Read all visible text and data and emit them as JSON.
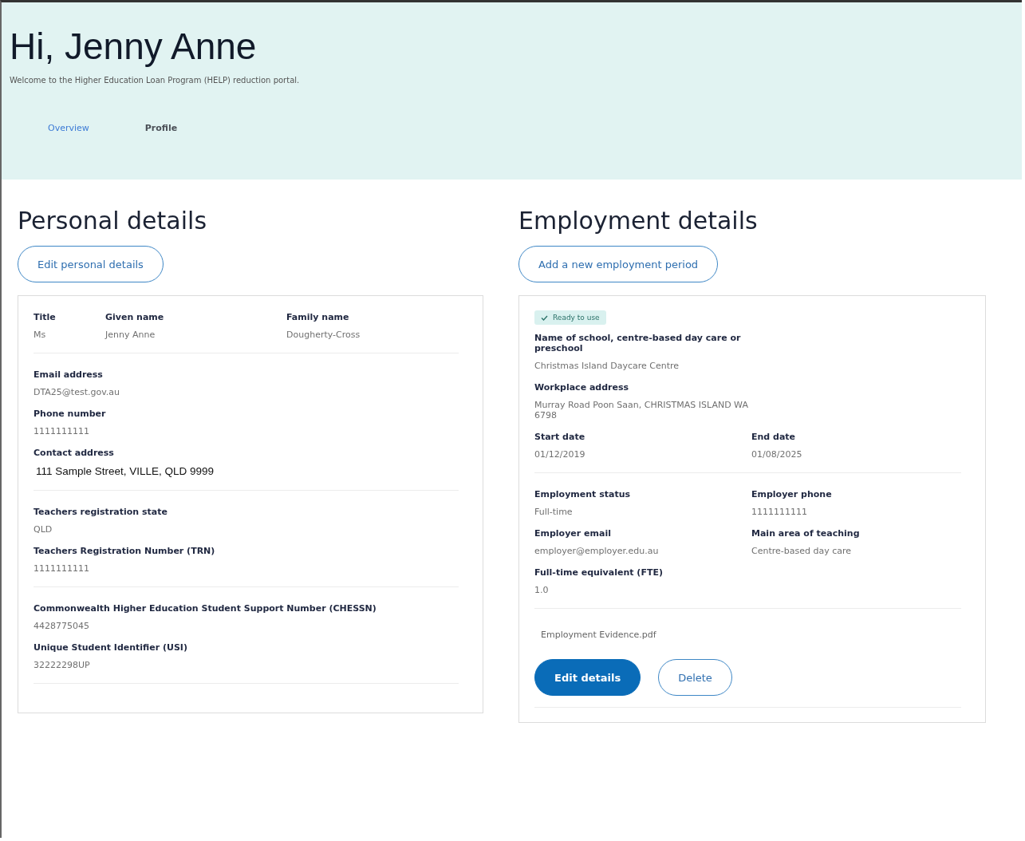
{
  "header": {
    "greeting": "Hi, Jenny Anne",
    "welcome": "Welcome to the Higher Education Loan Program (HELP) reduction portal."
  },
  "tabs": [
    {
      "label": "Overview",
      "selected": false
    },
    {
      "label": "Profile",
      "selected": true
    }
  ],
  "personal": {
    "title": "Personal details",
    "button": "Edit personal details",
    "sections": [
      {
        "rows": [
          [
            {
              "label": "Title",
              "value": "Ms",
              "kind": "text"
            },
            {
              "label": "Given name",
              "value": "Jenny Anne",
              "kind": "text"
            },
            {
              "label": "Family name",
              "value": "Dougherty-Cross",
              "kind": "text"
            }
          ]
        ]
      },
      {
        "rows": [
          [
            {
              "label": "Email address",
              "value": "DTA25@test.gov.au",
              "kind": "text"
            }
          ],
          [
            {
              "label": "Phone number",
              "value": "1111111111",
              "kind": "text"
            }
          ],
          [
            {
              "label": "Contact address",
              "value": "111 Sample Street, VILLE, QLD 9999",
              "kind": "plain"
            }
          ]
        ]
      },
      {
        "rows": [
          [
            {
              "label": "Teachers registration state",
              "value": "QLD",
              "kind": "text"
            }
          ],
          [
            {
              "label": "Teachers Registration Number (TRN)",
              "value": "1111111111",
              "kind": "text"
            }
          ]
        ]
      },
      {
        "rows": [
          [
            {
              "label": "Commonwealth Higher Education Student Support Number (CHESSN)",
              "value": "4428775045",
              "kind": "text"
            }
          ],
          [
            {
              "label": "Unique Student Identifier (USI)",
              "value": "32222298UP",
              "kind": "text"
            }
          ]
        ]
      }
    ]
  },
  "employment": {
    "title": "Employment details",
    "button": "Add a new employment period",
    "status": "Ready to use",
    "sections": [
      {
        "rows": [
          [
            {
              "label": "Name of school, centre-based day care or preschool",
              "value": "Christmas Island Daycare Centre",
              "kind": "text"
            }
          ],
          [
            {
              "label": "Workplace address",
              "value": "Murray Road Poon Saan, CHRISTMAS ISLAND WA 6798",
              "kind": "text"
            }
          ],
          [
            {
              "label": "Start date",
              "value": "01/12/2019",
              "kind": "text"
            },
            {
              "label": "End date",
              "value": "01/08/2025",
              "kind": "text"
            }
          ]
        ]
      },
      {
        "rows": [
          [
            {
              "label": "Employment status",
              "value": "Full-time",
              "kind": "text"
            },
            {
              "label": "Employer phone",
              "value": "1111111111",
              "kind": "text"
            }
          ],
          [
            {
              "label": "Employer email",
              "value": "employer@employer.edu.au",
              "kind": "text"
            },
            {
              "label": "Main area of teaching",
              "value": "Centre-based day care",
              "kind": "text"
            }
          ],
          [
            {
              "label": "Full-time equivalent (FTE)",
              "value": "1.0",
              "kind": "text"
            }
          ]
        ]
      }
    ],
    "attachment": "Employment Evidence.pdf",
    "actions": [
      {
        "label": "Edit details",
        "kind": "primary"
      },
      {
        "label": "Delete",
        "kind": "secondary"
      }
    ]
  }
}
